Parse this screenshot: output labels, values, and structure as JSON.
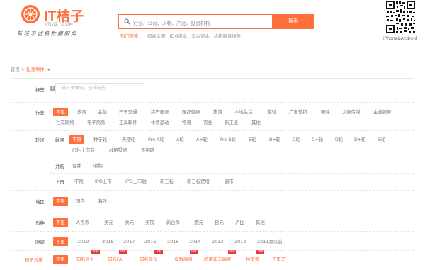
{
  "header": {
    "logo_text": "IT桔子",
    "logo_url": "ITJUZI.COM",
    "slogan": "新经济创投数据服务",
    "search_placeholder": "行业、公司、人物、产品、投资机构",
    "search_button": "搜索",
    "hot_label": "热门搜索：",
    "hot_items": [
      "蚂蚁金服",
      "IDG资本",
      "华兴资本",
      "机构解读报告"
    ],
    "qr_caption": "iPhone&Android"
  },
  "breadcrumb": {
    "home": "首页",
    "sep": ">",
    "current": "投资事件"
  },
  "filters": {
    "label_row": {
      "label": "标签",
      "info": "i",
      "placeholder": "输入关键词，选择标签"
    },
    "industry": {
      "label": "行业",
      "items": [
        "不限",
        "教育",
        "金融",
        "汽车交通",
        "房产服务",
        "医疗健康",
        "旅游",
        "本地生活",
        "游戏",
        "广告营销",
        "硬件",
        "文娱传媒",
        "企业服务",
        "社交网络",
        "电子商务",
        "工具软件",
        "体育运动",
        "物流",
        "农业",
        "新工业",
        "其他"
      ]
    },
    "rounds": {
      "label": "轮次",
      "financing_label": "融资",
      "financing": [
        "不限",
        "种子轮",
        "天使轮",
        "Pre-A轮",
        "A轮",
        "A+轮",
        "Pre-B轮",
        "B轮",
        "B+轮",
        "C轮",
        "C+轮",
        "D轮",
        "D+轮",
        "E轮",
        "F轮-上市前",
        "战略投资",
        "不明确"
      ],
      "merge_label": "并购",
      "merge": [
        "合并",
        "收购"
      ],
      "ipo_label": "上市",
      "ipo": [
        "不限",
        "IPO上市",
        "IPO上市后",
        "新三板",
        "新三板定增",
        "退市"
      ]
    },
    "region": {
      "label": "地区",
      "items": [
        "不限",
        "国内",
        "海外"
      ]
    },
    "currency": {
      "label": "币种",
      "items": [
        "不限",
        "人民币",
        "美元",
        "欧元",
        "英镑",
        "新台币",
        "港元",
        "日元",
        "卢比",
        "其他"
      ]
    },
    "time": {
      "label": "时间",
      "items": [
        "不限",
        "2019",
        "2018",
        "2017",
        "2016",
        "2015",
        "2014",
        "2013",
        "2012",
        "2011及以前"
      ]
    },
    "premium": {
      "label": "桔子优选",
      "items": [
        "不限",
        "知名企业",
        "知名FA",
        "知名风投",
        "一年数融资",
        "超两年未融资",
        "独角兽",
        "千里马"
      ],
      "vip_badge": "VIP"
    }
  },
  "colors": {
    "accent": "#ff6f3c",
    "vip": "#e23b3b"
  }
}
